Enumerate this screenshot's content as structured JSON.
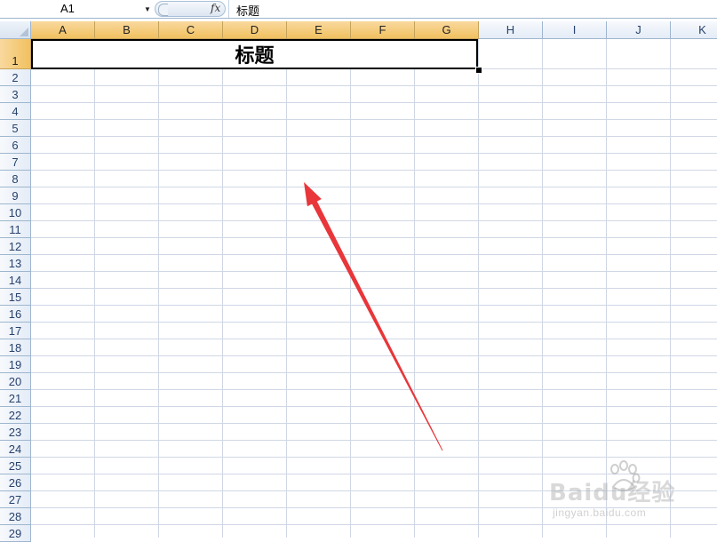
{
  "formula_bar": {
    "name_box": "A1",
    "fx_label": "fx",
    "formula_value": "标题"
  },
  "columns": [
    "A",
    "B",
    "C",
    "D",
    "E",
    "F",
    "G",
    "H",
    "I",
    "J",
    "K"
  ],
  "selected_columns": [
    "A",
    "B",
    "C",
    "D",
    "E",
    "F",
    "G"
  ],
  "rows": [
    "1",
    "2",
    "3",
    "4",
    "5",
    "6",
    "7",
    "8",
    "9",
    "10",
    "11",
    "12",
    "13",
    "14",
    "15",
    "16",
    "17",
    "18",
    "19",
    "20",
    "21",
    "22",
    "23",
    "24",
    "25",
    "26",
    "27",
    "28",
    "29"
  ],
  "selected_rows": [
    "1"
  ],
  "merged_cell": {
    "range": "A1:G1",
    "text": "标题"
  },
  "annotation": {
    "color": "#e8363a"
  },
  "watermark": {
    "brand": "Baidu经验",
    "url": "jingyan.baidu.com"
  },
  "colors": {
    "header_selected": "#f1c15f",
    "gridline": "#d0d7e5",
    "header_border": "#9eb6ce"
  }
}
